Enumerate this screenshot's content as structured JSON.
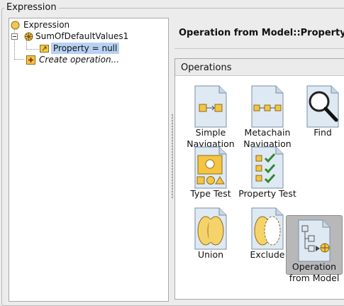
{
  "group": {
    "title": "Expression"
  },
  "tree": {
    "root": {
      "label": "Expression",
      "icon": "expression-icon"
    },
    "child": {
      "label": "SumOfDefaultValues1",
      "icon": "sum-icon"
    },
    "grandchild": {
      "label": "Property = null",
      "icon": "property-icon"
    },
    "create": {
      "label": "Create operation...",
      "icon": "add-icon"
    }
  },
  "right": {
    "header_title": "Operation from Model::Property"
  },
  "operations": {
    "title": "Operations",
    "items": [
      {
        "label": "Simple\nNavigation",
        "icon": "simple-navigation-icon"
      },
      {
        "label": "Metachain\nNavigation",
        "icon": "metachain-navigation-icon"
      },
      {
        "label": "Find",
        "icon": "magnifier-icon"
      },
      {
        "label": "Type Test",
        "icon": "type-test-icon"
      },
      {
        "label": "Property Test",
        "icon": "property-test-icon"
      },
      {
        "label": "Union",
        "icon": "union-icon"
      },
      {
        "label": "Exclude",
        "icon": "exclude-icon"
      },
      {
        "label": "Operation\nfrom Model",
        "icon": "operation-from-model-icon",
        "selected": true
      }
    ]
  }
}
